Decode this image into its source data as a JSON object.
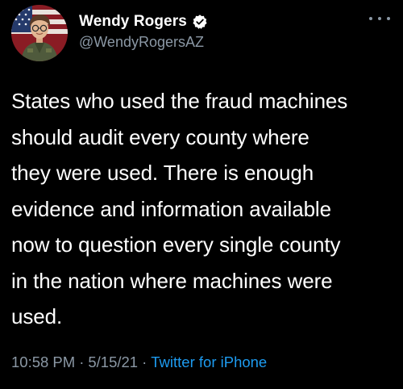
{
  "author": {
    "display_name": "Wendy Rogers",
    "handle": "@WendyRogersAZ",
    "verified_icon": "verified-badge-icon",
    "avatar_icon": "profile-avatar-icon"
  },
  "tweet": {
    "text": "States who used the fraud machines\nshould audit every county where\nthey were used. There is enough\nevidence and information available\nnow to question every single county\nin the nation where machines were\nused."
  },
  "meta": {
    "time": "10:58 PM",
    "separator": "·",
    "date": "5/15/21",
    "source": "Twitter for iPhone"
  },
  "menu": {
    "more_icon": "more-options-icon"
  },
  "colors": {
    "background": "#000000",
    "text": "#ffffff",
    "muted": "#8b98a5",
    "link": "#1d9bf0",
    "verified": "#ffffff"
  }
}
